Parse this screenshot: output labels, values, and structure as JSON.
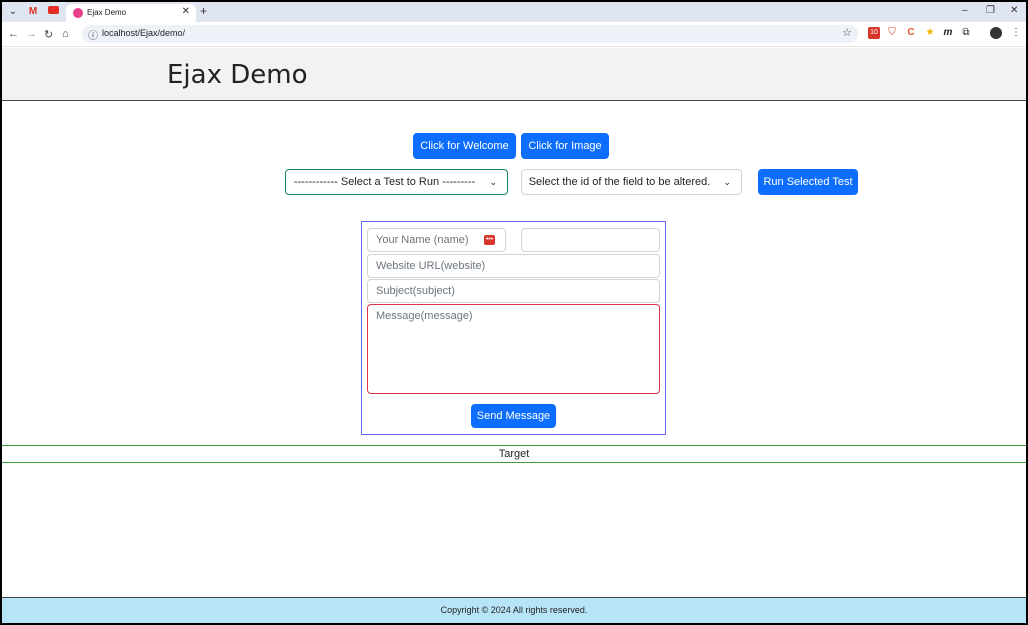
{
  "browser": {
    "tab_title": "Ejax Demo",
    "url": "localhost/Ejax/demo/",
    "extension_badge": "10"
  },
  "header": {
    "title": "Ejax Demo"
  },
  "buttons": {
    "welcome": "Click for Welcome",
    "image": "Click for Image",
    "run_test": "Run Selected Test",
    "send": "Send Message"
  },
  "selects": {
    "test": "------------ Select a Test to Run ---------",
    "field_id": "Select the id of the field to be altered."
  },
  "form": {
    "name_placeholder": "Your Name (name)",
    "website_placeholder": "Website URL(website)",
    "subject_placeholder": "Subject(subject)",
    "message_placeholder": "Message(message)"
  },
  "target": {
    "label": "Target"
  },
  "footer": {
    "text": "Copyright © 2024 All rights reserved."
  },
  "colors": {
    "primary": "#0d6efd",
    "footer_bg": "#b8e4f8",
    "target_border": "#3a9a3a",
    "form_border": "#6a6af0",
    "message_border": "#dc3545"
  }
}
